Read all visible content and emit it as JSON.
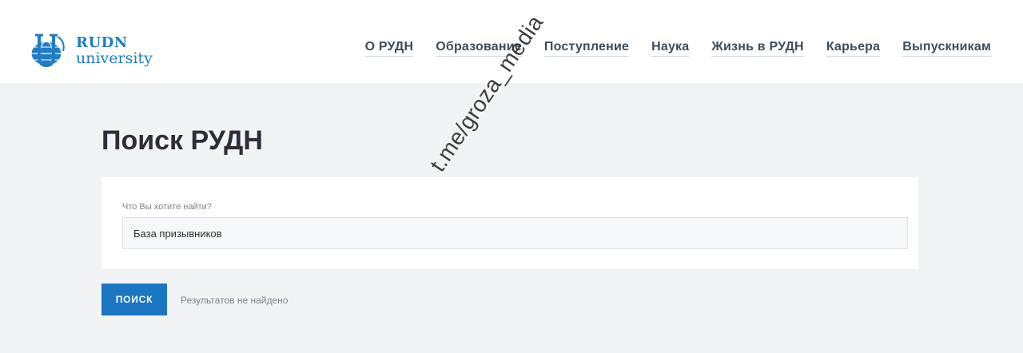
{
  "brand": {
    "name_line1": "RUDN",
    "name_line2": "university",
    "color": "#1f7cc4",
    "logo_icon": "rudn-globe-logo"
  },
  "nav": {
    "items": [
      {
        "label": "О РУДН"
      },
      {
        "label": "Образование"
      },
      {
        "label": "Поступление"
      },
      {
        "label": "Наука"
      },
      {
        "label": "Жизнь в РУДН"
      },
      {
        "label": "Карьера"
      },
      {
        "label": "Выпускникам"
      }
    ]
  },
  "page": {
    "title": "Поиск РУДН"
  },
  "search": {
    "label": "Что Вы хотите найти?",
    "value": "База призывников",
    "button_label": "ПОИСК",
    "button_color": "#1b76c2",
    "results_text": "Результатов не найдено"
  },
  "watermark": {
    "text": "t.me/groza_media"
  }
}
